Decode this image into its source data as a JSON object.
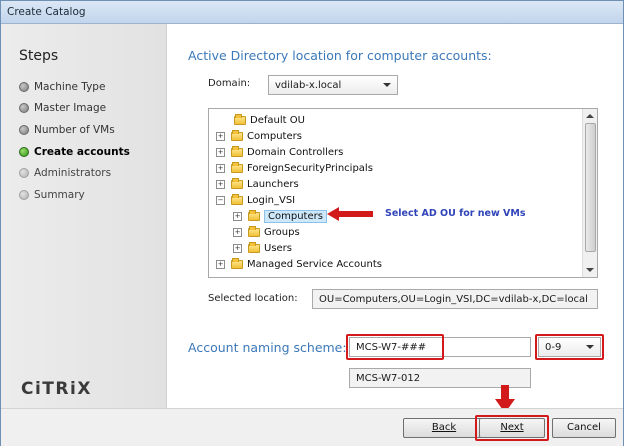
{
  "window": {
    "title": "Create Catalog"
  },
  "sidebar": {
    "title": "Steps",
    "steps": [
      {
        "label": "Machine Type",
        "state": "done"
      },
      {
        "label": "Master Image",
        "state": "done"
      },
      {
        "label": "Number of VMs",
        "state": "done"
      },
      {
        "label": "Create accounts",
        "state": "current"
      },
      {
        "label": "Administrators",
        "state": "future"
      },
      {
        "label": "Summary",
        "state": "future"
      }
    ],
    "logo": "CiTRiX"
  },
  "ad_section": {
    "title": "Active Directory location for computer accounts:",
    "domain_label": "Domain:",
    "domain_value": "vdilab-x.local",
    "tree": [
      {
        "label": "Default OU",
        "expander": "",
        "depth": 0,
        "selected": false
      },
      {
        "label": "Computers",
        "expander": "+",
        "depth": 0,
        "selected": false
      },
      {
        "label": "Domain Controllers",
        "expander": "+",
        "depth": 0,
        "selected": false
      },
      {
        "label": "ForeignSecurityPrincipals",
        "expander": "+",
        "depth": 0,
        "selected": false
      },
      {
        "label": "Launchers",
        "expander": "+",
        "depth": 0,
        "selected": false
      },
      {
        "label": "Login_VSI",
        "expander": "−",
        "depth": 0,
        "selected": false
      },
      {
        "label": "Computers",
        "expander": "+",
        "depth": 1,
        "selected": true
      },
      {
        "label": "Groups",
        "expander": "+",
        "depth": 1,
        "selected": false
      },
      {
        "label": "Users",
        "expander": "+",
        "depth": 1,
        "selected": false
      },
      {
        "label": "Managed Service Accounts",
        "expander": "+",
        "depth": 0,
        "selected": false
      }
    ],
    "callout": "Select AD OU for new VMs",
    "selected_location_label": "Selected location:",
    "selected_location_value": "OU=Computers,OU=Login_VSI,DC=vdilab-x,DC=local"
  },
  "naming": {
    "title": "Account naming scheme:",
    "scheme_value": "MCS-W7-###",
    "scheme_type": "0-9",
    "preview": "MCS-W7-012"
  },
  "buttons": {
    "back": "Back",
    "next": "Next",
    "cancel": "Cancel"
  },
  "colors": {
    "accent": "#3b78b9",
    "annotation": "#d21a1a",
    "callout_text": "#3044b8"
  }
}
